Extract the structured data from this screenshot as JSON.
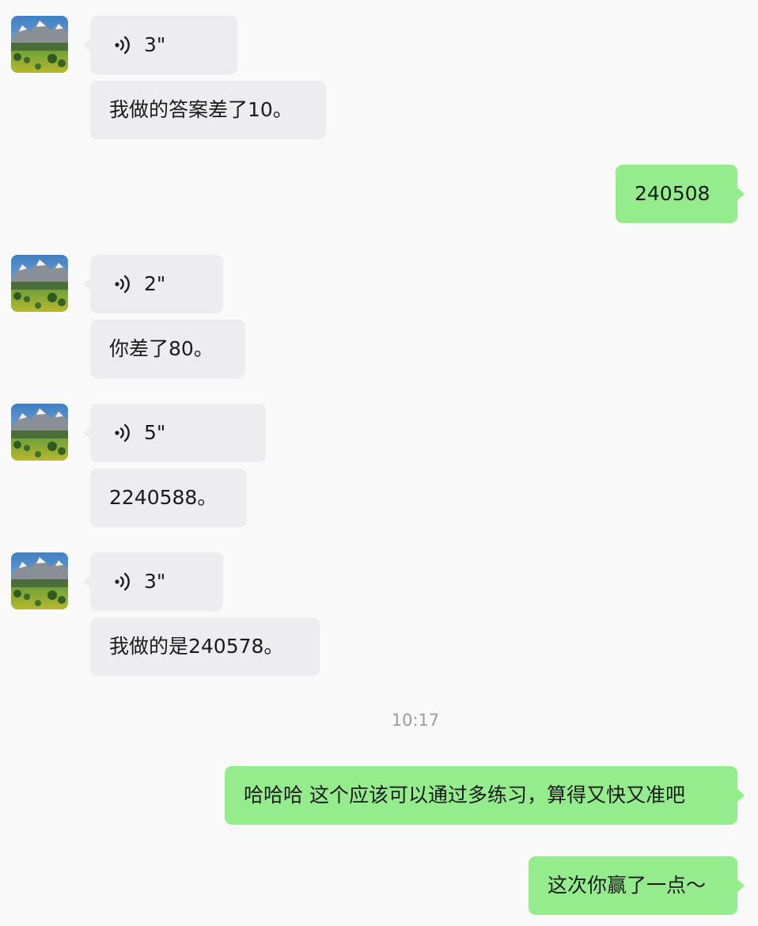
{
  "messages": [
    {
      "from": "other",
      "type": "voice",
      "duration": "3\""
    },
    {
      "from": "other",
      "type": "text",
      "text": "我做的答案差了10。"
    },
    {
      "from": "me",
      "type": "text",
      "text": "240508"
    },
    {
      "from": "other",
      "type": "voice",
      "duration": "2\""
    },
    {
      "from": "other",
      "type": "text",
      "text": "你差了80。"
    },
    {
      "from": "other",
      "type": "voice",
      "duration": "5\""
    },
    {
      "from": "other",
      "type": "text",
      "text": "2240588。"
    },
    {
      "from": "other",
      "type": "voice",
      "duration": "3\""
    },
    {
      "from": "other",
      "type": "text",
      "text": "我做的是240578。"
    },
    {
      "from": "system",
      "type": "timestamp",
      "text": "10:17"
    },
    {
      "from": "me",
      "type": "text",
      "text": "哈哈哈 这个应该可以通过多练习，算得又快又准吧"
    },
    {
      "from": "me",
      "type": "text",
      "text": "这次你赢了一点～"
    }
  ],
  "colors": {
    "background": "#f9f9f9",
    "incoming_bubble": "#ededef",
    "outgoing_bubble": "#95ec8c",
    "timestamp_text": "#9c9c9c"
  },
  "icons": {
    "voice": "voice-wave-icon",
    "avatar": "mountain-landscape-avatar"
  }
}
